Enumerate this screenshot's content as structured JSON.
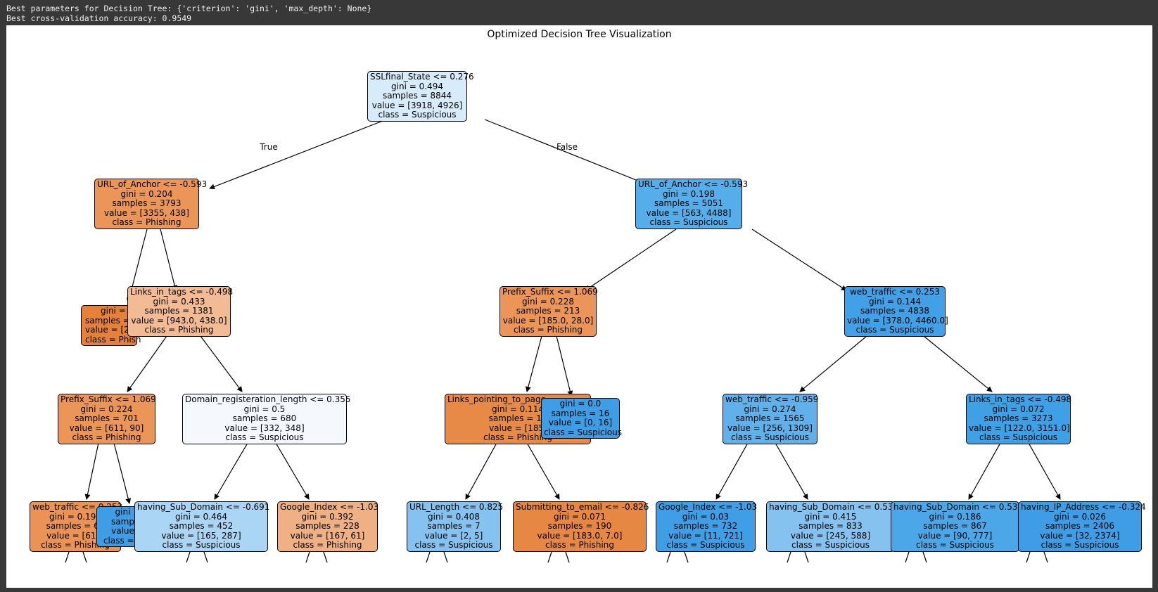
{
  "console": {
    "line1": "Best parameters for Decision Tree: {'criterion': 'gini', 'max_depth': None}",
    "line2": "Best cross-validation accuracy: 0.9549"
  },
  "figure": {
    "title": "Optimized Decision Tree Visualization",
    "true_label": "True",
    "false_label": "False"
  },
  "colors": {
    "phishing_strong": "#e5813a",
    "phishing_med": "#eb9558",
    "phishing_light": "#f2bb93",
    "suspicious_strong": "#3e9de5",
    "suspicious_med": "#55ade9",
    "suspicious_light": "#85c2ef",
    "neutral": "#f5f9fe",
    "root": "#d8ebfa"
  },
  "nodes": {
    "root": {
      "l1": "SSLfinal_State <= 0.276",
      "l2": "gini = 0.494",
      "l3": "samples = 8844",
      "l4": "value = [3918, 4926]",
      "l5": "class = Suspicious"
    },
    "l_anchor": {
      "l1": "URL_of_Anchor <= -0.593",
      "l2": "gini = 0.204",
      "l3": "samples = 3793",
      "l4": "value = [3355, 438]",
      "l5": "class = Phishing"
    },
    "r_anchor": {
      "l1": "URL_of_Anchor <= -0.593",
      "l2": "gini = 0.198",
      "l3": "samples = 5051",
      "l4": "value = [563, 4488]",
      "l5": "class = Suspicious"
    },
    "ll_leaf": {
      "l1": "gini = 0",
      "l2": "samples = ",
      "l3": "value = [24",
      "l4": "class = Phish"
    },
    "links_tags_l": {
      "l1": "Links_in_tags <= -0.498",
      "l2": "gini = 0.433",
      "l3": "samples = 1381",
      "l4": "value = [943.0, 438.0]",
      "l5": "class = Phishing"
    },
    "prefix_r": {
      "l1": "Prefix_Suffix <= 1.069",
      "l2": "gini = 0.228",
      "l3": "samples = 213",
      "l4": "value = [185.0, 28.0]",
      "l5": "class = Phishing"
    },
    "web_traffic_r": {
      "l1": "web_traffic <= 0.253",
      "l2": "gini = 0.144",
      "l3": "samples = 4838",
      "l4": "value = [378.0, 4460.0]",
      "l5": "class = Suspicious"
    },
    "prefix_l": {
      "l1": "Prefix_Suffix <= 1.069",
      "l2": "gini = 0.224",
      "l3": "samples = 701",
      "l4": "value = [611, 90]",
      "l5": "class = Phishing"
    },
    "domain_reg": {
      "l1": "Domain_registeration_length <= 0.355",
      "l2": "gini = 0.5",
      "l3": "samples = 680",
      "l4": "value = [332, 348]",
      "l5": "class = Suspicious"
    },
    "links_pointing": {
      "l1": "Links_pointing_to_page",
      "l2": "gini = 0.114",
      "l3": "samples = 19",
      "l4": "value = [185,",
      "l5": "class = Phishing"
    },
    "leaf_16": {
      "l1": "gini = 0.0",
      "l2": "samples = 16",
      "l3": "value = [0, 16]",
      "l4": "class = Suspicious"
    },
    "web_traffic_rl": {
      "l1": "web_traffic <= -0.959",
      "l2": "gini = 0.274",
      "l3": "samples = 1565",
      "l4": "value = [256, 1309]",
      "l5": "class = Suspicious"
    },
    "links_tags_r": {
      "l1": "Links_in_tags <= -0.498",
      "l2": "gini = 0.072",
      "l3": "samples = 3273",
      "l4": "value = [122.0, 3151.0]",
      "l5": "class = Suspicious"
    },
    "web_traffic_ll": {
      "l1": "web_traffic <= 0.253",
      "l2": "gini = 0.197",
      "l3": "samples = 68",
      "l4": "value = [611,",
      "l5": "class = Phishing"
    },
    "small_leaf": {
      "l1": "gini",
      "l2": "samp",
      "l3": "value",
      "l4": "class = S"
    },
    "sub_domain_1": {
      "l1": "having_Sub_Domain <= -0.691",
      "l2": "gini = 0.464",
      "l3": "samples = 452",
      "l4": "value = [165, 287]",
      "l5": "class = Suspicious"
    },
    "google_1": {
      "l1": "Google_Index <= -1.03",
      "l2": "gini = 0.392",
      "l3": "samples = 228",
      "l4": "value = [167, 61]",
      "l5": "class = Phishing"
    },
    "url_length": {
      "l1": "URL_Length <= 0.825",
      "l2": "gini = 0.408",
      "l3": "samples = 7",
      "l4": "value = [2, 5]",
      "l5": "class = Suspicious"
    },
    "submit_email": {
      "l1": "Submitting_to_email <= -0.826",
      "l2": "gini = 0.071",
      "l3": "samples = 190",
      "l4": "value = [183.0, 7.0]",
      "l5": "class = Phishing"
    },
    "google_2": {
      "l1": "Google_Index <= -1.03",
      "l2": "gini = 0.03",
      "l3": "samples = 732",
      "l4": "value = [11, 721]",
      "l5": "class = Suspicious"
    },
    "sub_domain_2": {
      "l1": "having_Sub_Domain <= 0.533",
      "l2": "gini = 0.415",
      "l3": "samples = 833",
      "l4": "value = [245, 588]",
      "l5": "class = Suspicious"
    },
    "sub_domain_3": {
      "l1": "having_Sub_Domain <= 0.533",
      "l2": "gini = 0.186",
      "l3": "samples = 867",
      "l4": "value = [90, 777]",
      "l5": "class = Suspicious"
    },
    "ip_address": {
      "l1": "having_IP_Address <= -0.324",
      "l2": "gini = 0.026",
      "l3": "samples = 2406",
      "l4": "value = [32, 2374]",
      "l5": "class = Suspicious"
    }
  }
}
